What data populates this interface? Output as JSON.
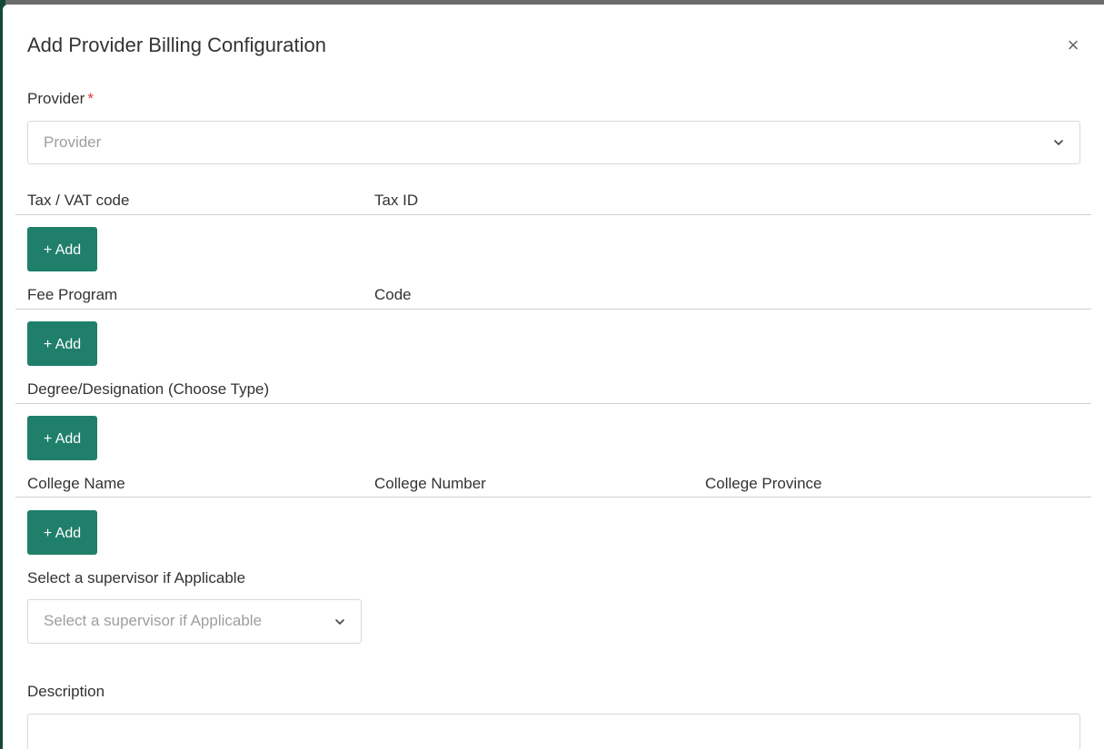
{
  "modal": {
    "title": "Add Provider Billing Configuration",
    "close_symbol": "×"
  },
  "provider": {
    "label": "Provider",
    "required_mark": "*",
    "placeholder": "Provider"
  },
  "tax_section": {
    "columns": [
      "Tax / VAT code",
      "Tax ID"
    ],
    "add_label": "+ Add"
  },
  "fee_section": {
    "columns": [
      "Fee Program",
      "Code"
    ],
    "add_label": "+ Add"
  },
  "degree_section": {
    "columns": [
      "Degree/Designation (Choose Type)"
    ],
    "add_label": "+ Add"
  },
  "college_section": {
    "columns": [
      "College Name",
      "College Number",
      "College Province"
    ],
    "add_label": "+ Add"
  },
  "supervisor": {
    "label": "Select a supervisor if Applicable",
    "placeholder": "Select a supervisor if Applicable"
  },
  "description": {
    "label": "Description",
    "value": ""
  },
  "icons": {
    "close": "close-icon",
    "dropdown": "chevron-down-icon"
  },
  "colors": {
    "accent": "#1f7f6b",
    "required": "#e53935",
    "border": "#d9d9d9",
    "placeholder": "#9e9e9e"
  }
}
